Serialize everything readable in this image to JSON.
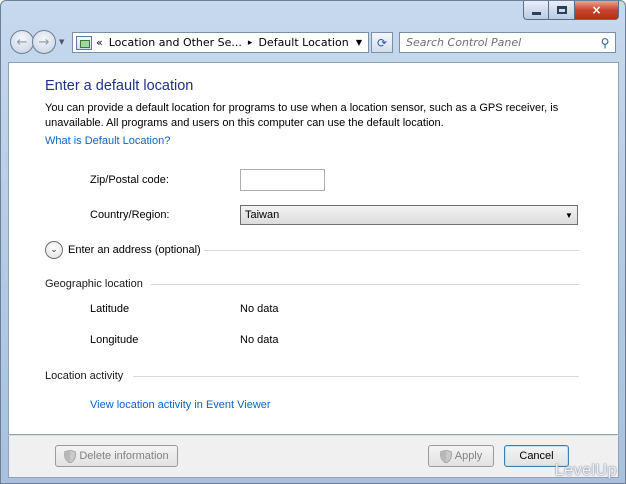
{
  "window": {
    "caption": {
      "minimize_icon": "minimize-icon",
      "maximize_icon": "maximize-icon",
      "close_icon": "close-icon",
      "close_glyph": "×"
    }
  },
  "nav": {
    "back_glyph": "←",
    "forward_glyph": "→",
    "history_glyph": "▼"
  },
  "address_bar": {
    "overflow": "«",
    "crumb_1": "Location and Other Se...",
    "separator": "▸",
    "crumb_2": "Default Location",
    "dropdown_glyph": "▼",
    "refresh_glyph": "⟳"
  },
  "search": {
    "placeholder": "Search Control Panel",
    "icon_glyph": "⚲"
  },
  "page": {
    "title": "Enter a default location",
    "description": "You can provide a default location for programs to use when a location sensor, such as a GPS receiver, is unavailable. All programs and users on this computer can use the default location.",
    "help_link": "What is Default Location?"
  },
  "form": {
    "zip_label": "Zip/Postal code:",
    "zip_value": "",
    "country_label": "Country/Region:",
    "country_value": "Taiwan",
    "country_arrow": "▼",
    "expander_glyph": "⌄",
    "expander_label": "Enter an address (optional)"
  },
  "geographic": {
    "heading": "Geographic location",
    "latitude_label": "Latitude",
    "latitude_value": "No data",
    "longitude_label": "Longitude",
    "longitude_value": "No data"
  },
  "activity": {
    "heading": "Location activity",
    "link": "View location activity in Event Viewer"
  },
  "buttons": {
    "delete": "Delete information",
    "apply": "Apply",
    "cancel": "Cancel"
  },
  "watermark": "LevelUp",
  "colors": {
    "title": "#1e3287",
    "link": "#0b66c5",
    "chrome": "#b3c9e3",
    "close": "#c7442b"
  }
}
